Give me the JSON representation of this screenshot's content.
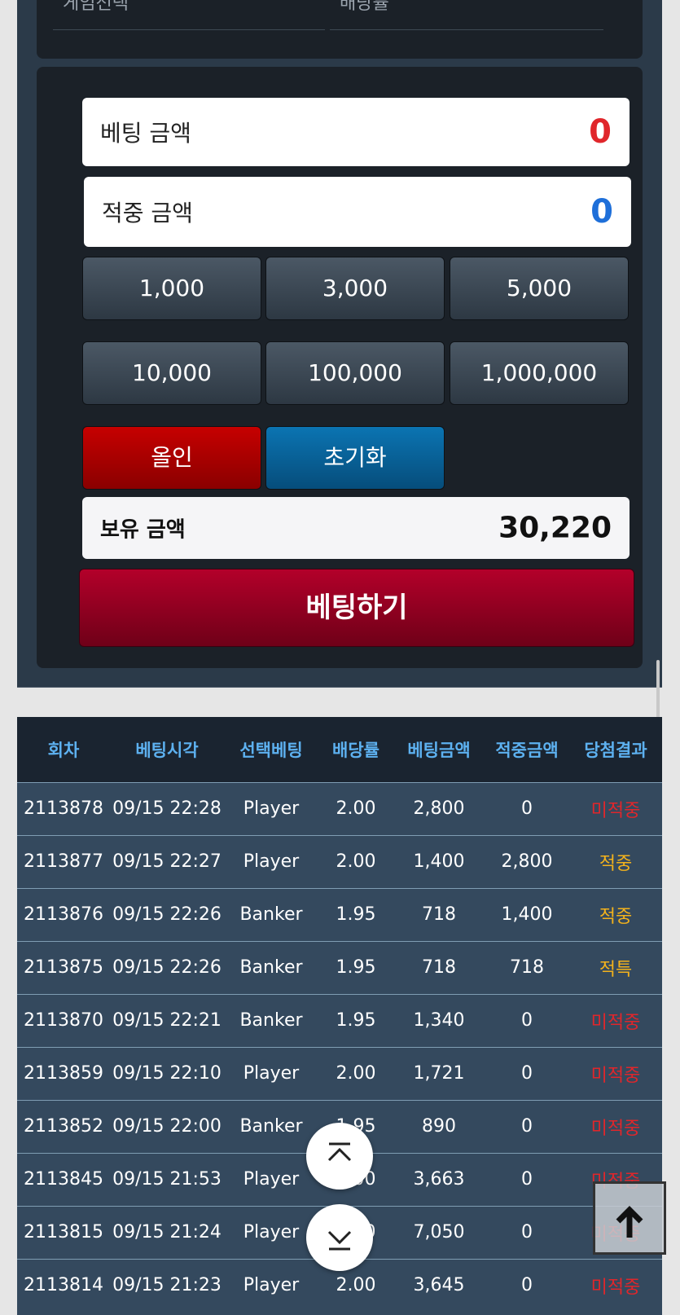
{
  "top_panel": {
    "game_select_label": "게임선택",
    "odds_label": "배당률"
  },
  "bet_form": {
    "bet_amount_label": "베팅 금액",
    "bet_amount_value": "0",
    "win_amount_label": "적중 금액",
    "win_amount_value": "0",
    "amount_buttons": [
      "1,000",
      "3,000",
      "5,000",
      "10,000",
      "100,000",
      "1,000,000"
    ],
    "all_in_label": "올인",
    "reset_label": "초기화",
    "balance_label": "보유 금액",
    "balance_value": "30,220",
    "submit_label": "베팅하기",
    "colors": {
      "bet_value": "#e0262b",
      "win_value": "#1e6fd9"
    }
  },
  "history": {
    "columns": [
      "회차",
      "베팅시각",
      "선택베팅",
      "배당률",
      "베팅금액",
      "적중금액",
      "당첨결과"
    ],
    "rows": [
      [
        "2113878",
        "09/15 22:28",
        "Player",
        "2.00",
        "2,800",
        "0",
        "미적중"
      ],
      [
        "2113877",
        "09/15 22:27",
        "Player",
        "2.00",
        "1,400",
        "2,800",
        "적중"
      ],
      [
        "2113876",
        "09/15 22:26",
        "Banker",
        "1.95",
        "718",
        "1,400",
        "적중"
      ],
      [
        "2113875",
        "09/15 22:26",
        "Banker",
        "1.95",
        "718",
        "718",
        "적특"
      ],
      [
        "2113870",
        "09/15 22:21",
        "Banker",
        "1.95",
        "1,340",
        "0",
        "미적중"
      ],
      [
        "2113859",
        "09/15 22:10",
        "Player",
        "2.00",
        "1,721",
        "0",
        "미적중"
      ],
      [
        "2113852",
        "09/15 22:00",
        "Banker",
        "1.95",
        "890",
        "0",
        "미적중"
      ],
      [
        "2113845",
        "09/15 21:53",
        "Player",
        "2.00",
        "3,663",
        "0",
        "미적중"
      ],
      [
        "2113815",
        "09/15 21:24",
        "Player",
        "2.00",
        "7,050",
        "0",
        "미적중"
      ],
      [
        "2113814",
        "09/15 21:23",
        "Player",
        "2.00",
        "3,645",
        "0",
        "미적중"
      ]
    ],
    "colors": {
      "hit": "#f3b21c",
      "miss": "#e0262b"
    }
  },
  "floating": {
    "scroll_top_icon": "chevron-up-bar-icon",
    "scroll_bottom_icon": "chevron-down-bar-icon",
    "back_to_top_icon": "arrow-up-icon"
  }
}
